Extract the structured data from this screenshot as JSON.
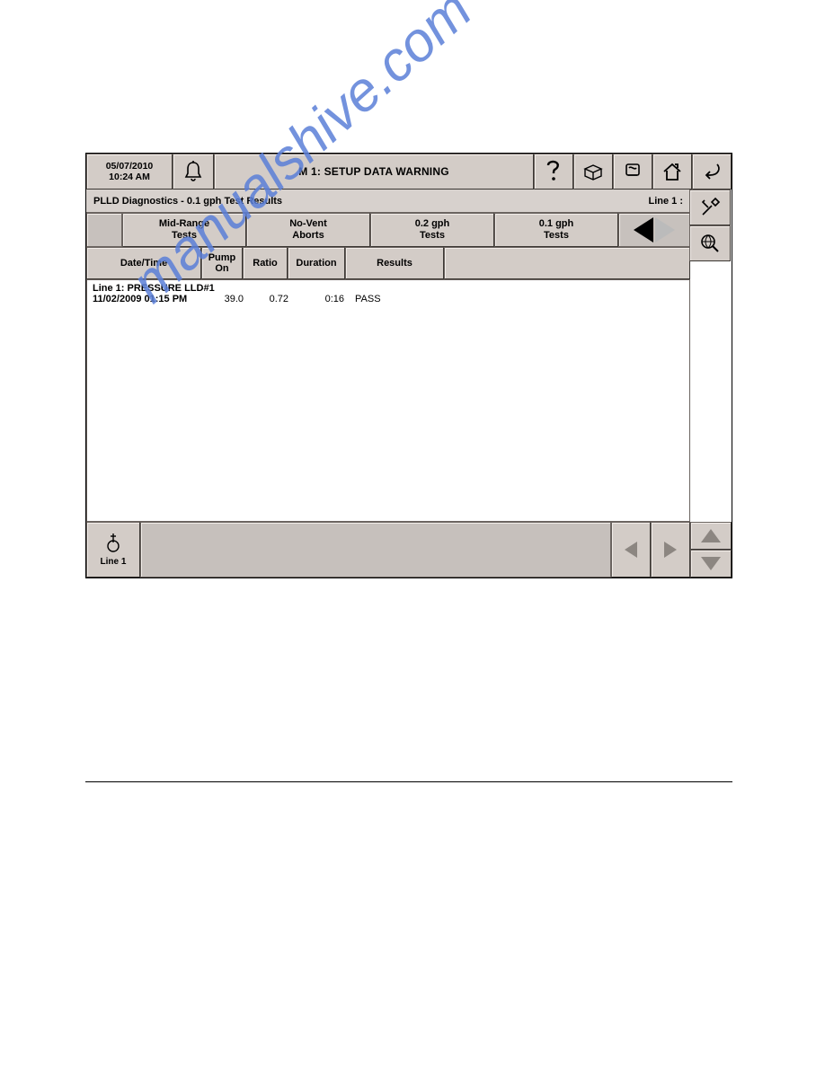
{
  "header": {
    "date": "05/07/2010",
    "time": "10:24 AM",
    "title": "M 1: SETUP DATA WARNING"
  },
  "subheader": {
    "title": "PLLD Diagnostics - 0.1 gph Test Results",
    "line_label": "Line 1 :"
  },
  "tabs": {
    "mid_range": "Mid-Range\nTests",
    "no_vent": "No-Vent\nAborts",
    "gph_02": "0.2 gph\nTests",
    "gph_01": "0.1 gph\nTests"
  },
  "columns": {
    "datetime": "Date/Time",
    "pump": "Pump\nOn",
    "ratio": "Ratio",
    "duration": "Duration",
    "results": "Results"
  },
  "data": {
    "group_header": "Line 1: PRESSURE LLD#1",
    "row": {
      "datetime": "11/02/2009 01:15 PM",
      "pump_on": "39.0",
      "ratio": "0.72",
      "duration": "0:16",
      "result": "PASS"
    }
  },
  "bottom": {
    "line_label": "Line 1"
  },
  "watermark": "manualshive.com"
}
